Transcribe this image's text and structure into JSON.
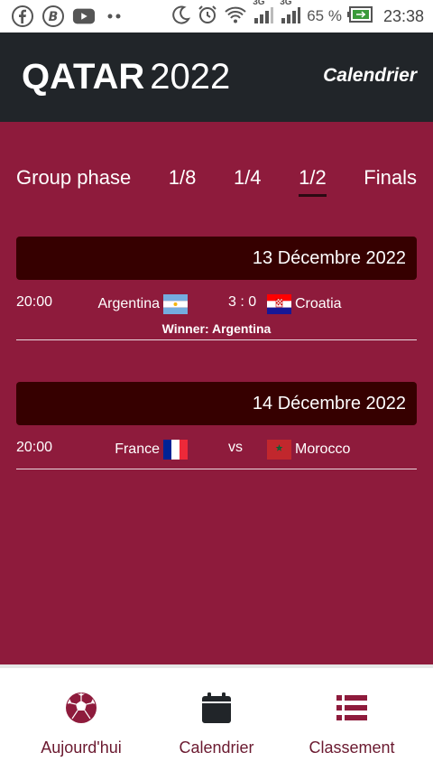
{
  "status_bar": {
    "battery_percent": "65 %",
    "time": "23:38",
    "network_1": "3G",
    "network_2": "3G"
  },
  "header": {
    "brand_bold": "QATAR",
    "brand_light": "2022",
    "title": "Calendrier"
  },
  "tabs": [
    {
      "label": "Group phase"
    },
    {
      "label": "1/8"
    },
    {
      "label": "1/4"
    },
    {
      "label": "1/2"
    },
    {
      "label": "Finals"
    }
  ],
  "active_tab": "1/2",
  "days": [
    {
      "date": "13 Décembre 2022",
      "match": {
        "time": "20:00",
        "home": "Argentina",
        "score": "3 : 0",
        "away": "Croatia",
        "winner": "Winner: Argentina"
      }
    },
    {
      "date": "14 Décembre 2022",
      "match": {
        "time": "20:00",
        "home": "France",
        "score": "vs",
        "away": "Morocco"
      }
    }
  ],
  "bottom_nav": [
    {
      "label": "Aujourd'hui",
      "icon": "soccer-ball-icon"
    },
    {
      "label": "Calendrier",
      "icon": "calendar-icon"
    },
    {
      "label": "Classement",
      "icon": "list-icon"
    }
  ],
  "colors": {
    "background": "#8E1B3C",
    "header": "#212529",
    "day_header": "#360000",
    "nav_accent": "#8E1B3C"
  }
}
